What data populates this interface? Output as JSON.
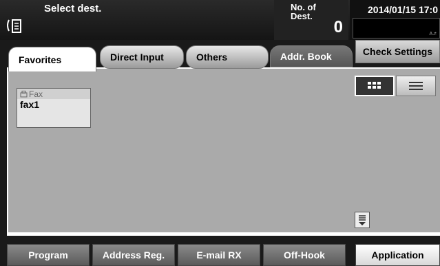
{
  "header": {
    "title": "Select dest.",
    "num_dest_label": "No. of\nDest.",
    "num_dest_value": "0",
    "datetime": "2014/01/15 17:0",
    "status_text": "A.≠"
  },
  "tabs": [
    {
      "label": "Favorites",
      "active": true
    },
    {
      "label": "Direct Input",
      "active": false
    },
    {
      "label": "Others",
      "active": false
    },
    {
      "label": "Addr. Book",
      "active": false
    }
  ],
  "check_settings_label": "Check Settings",
  "destinations": [
    {
      "type": "Fax",
      "name": "fax1"
    }
  ],
  "bottom_buttons": [
    {
      "label": "Program"
    },
    {
      "label": "Address Reg."
    },
    {
      "label": "E-mail RX"
    },
    {
      "label": "Off-Hook"
    },
    {
      "label": "Application"
    }
  ],
  "colors": {
    "background": "#1a1a1a",
    "panel": "#aaaaaa",
    "active_tab": "#ffffff"
  }
}
